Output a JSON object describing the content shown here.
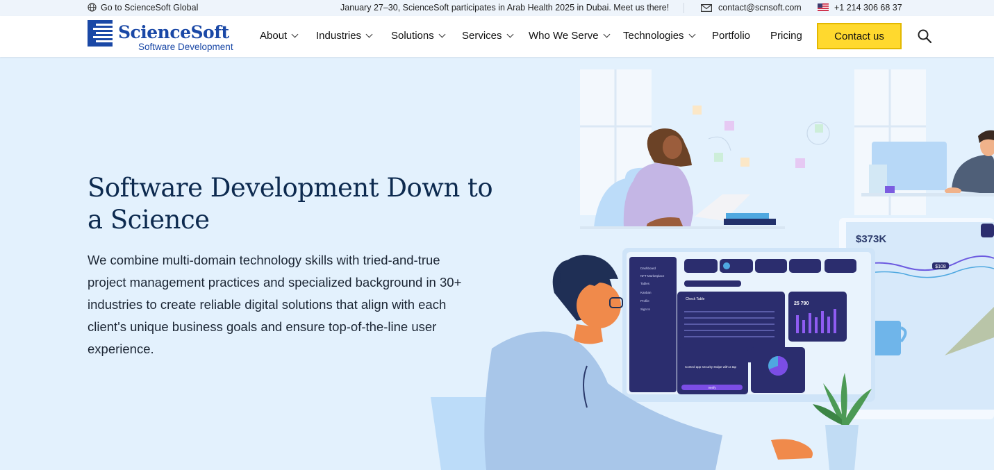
{
  "topbar": {
    "global_link": "Go to ScienceSoft Global",
    "announcement": "January 27–30, ScienceSoft participates in Arab Health 2025 in Dubai. Meet us there!",
    "email": "contact@scnsoft.com",
    "phone": "+1 214 306 68 37",
    "icons": [
      "globe-icon",
      "mail-icon",
      "us-flag-icon"
    ]
  },
  "logo": {
    "name": "ScienceSoft",
    "subtitle": "Software Development"
  },
  "nav": {
    "items": [
      {
        "label": "About",
        "dropdown": true
      },
      {
        "label": "Industries",
        "dropdown": true
      },
      {
        "label": "Solutions",
        "dropdown": true
      },
      {
        "label": "Services",
        "dropdown": true
      },
      {
        "label": "Who We Serve",
        "dropdown": true
      },
      {
        "label": "Technologies",
        "dropdown": true
      },
      {
        "label": "Portfolio",
        "dropdown": false
      },
      {
        "label": "Pricing",
        "dropdown": false
      }
    ],
    "cta": "Contact us",
    "search_icon": "search-icon"
  },
  "hero": {
    "title": "Software Development Down to a Science",
    "text": "We combine multi-domain technology skills with tried-and-true project management practices and specialized background in 30+ industries to create reliable digital solutions that align with each client's unique business goals and ensure top-of-the-line user experience."
  },
  "illustration": {
    "dashboard_menu": [
      "Dashboard",
      "NFT Marketplace",
      "Tables",
      "Kanban",
      "Profile",
      "Sign In"
    ],
    "check_table_title": "Check Table",
    "chart_value": "25 790",
    "security_card": "Control app security Swipe with a tap",
    "card_button": "Verify",
    "side_value": "$373K",
    "side_badge": "$108"
  },
  "colors": {
    "accent": "#ffd92e",
    "brand": "#1a48a6",
    "hero_bg": "#e3f1fd",
    "dashboard": "#2b2d6e"
  }
}
